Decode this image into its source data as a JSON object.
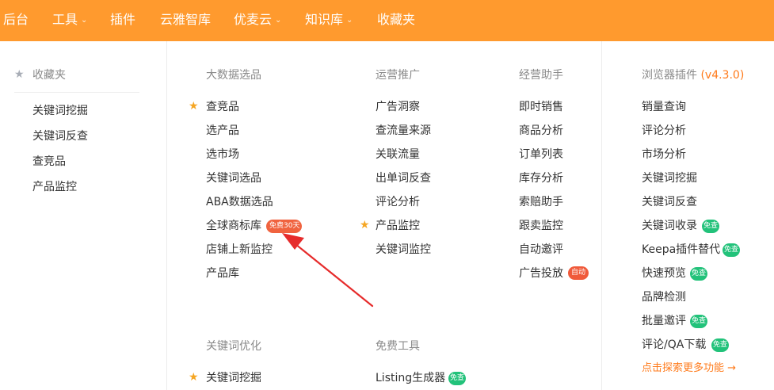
{
  "nav": {
    "items": [
      {
        "label": "后台",
        "caret": false
      },
      {
        "label": "工具",
        "caret": true
      },
      {
        "label": "插件",
        "caret": false
      },
      {
        "label": "云雅智库",
        "caret": false
      },
      {
        "label": "优麦云",
        "caret": true
      },
      {
        "label": "知识库",
        "caret": true
      },
      {
        "label": "收藏夹",
        "caret": false
      }
    ],
    "caret_glyph": "⌄"
  },
  "favorites": {
    "title": "收藏夹",
    "items": [
      "关键词挖掘",
      "关键词反查",
      "查竞品",
      "产品监控"
    ]
  },
  "bigdata": {
    "title": "大数据选品",
    "items": [
      "查竞品",
      "选产品",
      "选市场",
      "关键词选品",
      "ABA数据选品",
      "全球商标库",
      "店铺上新监控",
      "产品库"
    ],
    "trademark_badge": "免费30天"
  },
  "operations": {
    "title": "运营推广",
    "items": [
      "广告洞察",
      "查流量来源",
      "关联流量",
      "出单词反查",
      "评论分析",
      "产品监控",
      "关键词监控"
    ]
  },
  "assistant": {
    "title": "经营助手",
    "items": [
      "即时销售",
      "商品分析",
      "订单列表",
      "库存分析",
      "索赔助手",
      "跟卖监控",
      "自动邀评",
      "广告投放"
    ],
    "ads_badge": "自动"
  },
  "plugin": {
    "title": "浏览器插件",
    "version": "(v4.3.0)",
    "items": [
      "销量查询",
      "评论分析",
      "市场分析",
      "关键词挖掘",
      "关键词反查",
      "关键词收录",
      "Keepa插件替代",
      "快速预览",
      "品牌检测",
      "批量邀评",
      "评论/QA下载"
    ],
    "free_badge": "免查",
    "more": "点击探索更多功能 →"
  },
  "keyword_opt": {
    "title": "关键词优化",
    "items": [
      "关键词挖掘"
    ]
  },
  "free_tools": {
    "title": "免费工具",
    "items": [
      "Listing生成器"
    ]
  },
  "colors": {
    "topbar": "#ff9a2e",
    "star": "#f5a623",
    "badge_green": "#22c27a",
    "badge_red": "#f05a3a",
    "arrow": "#e62b2b",
    "link_orange": "#ff7a1a"
  }
}
